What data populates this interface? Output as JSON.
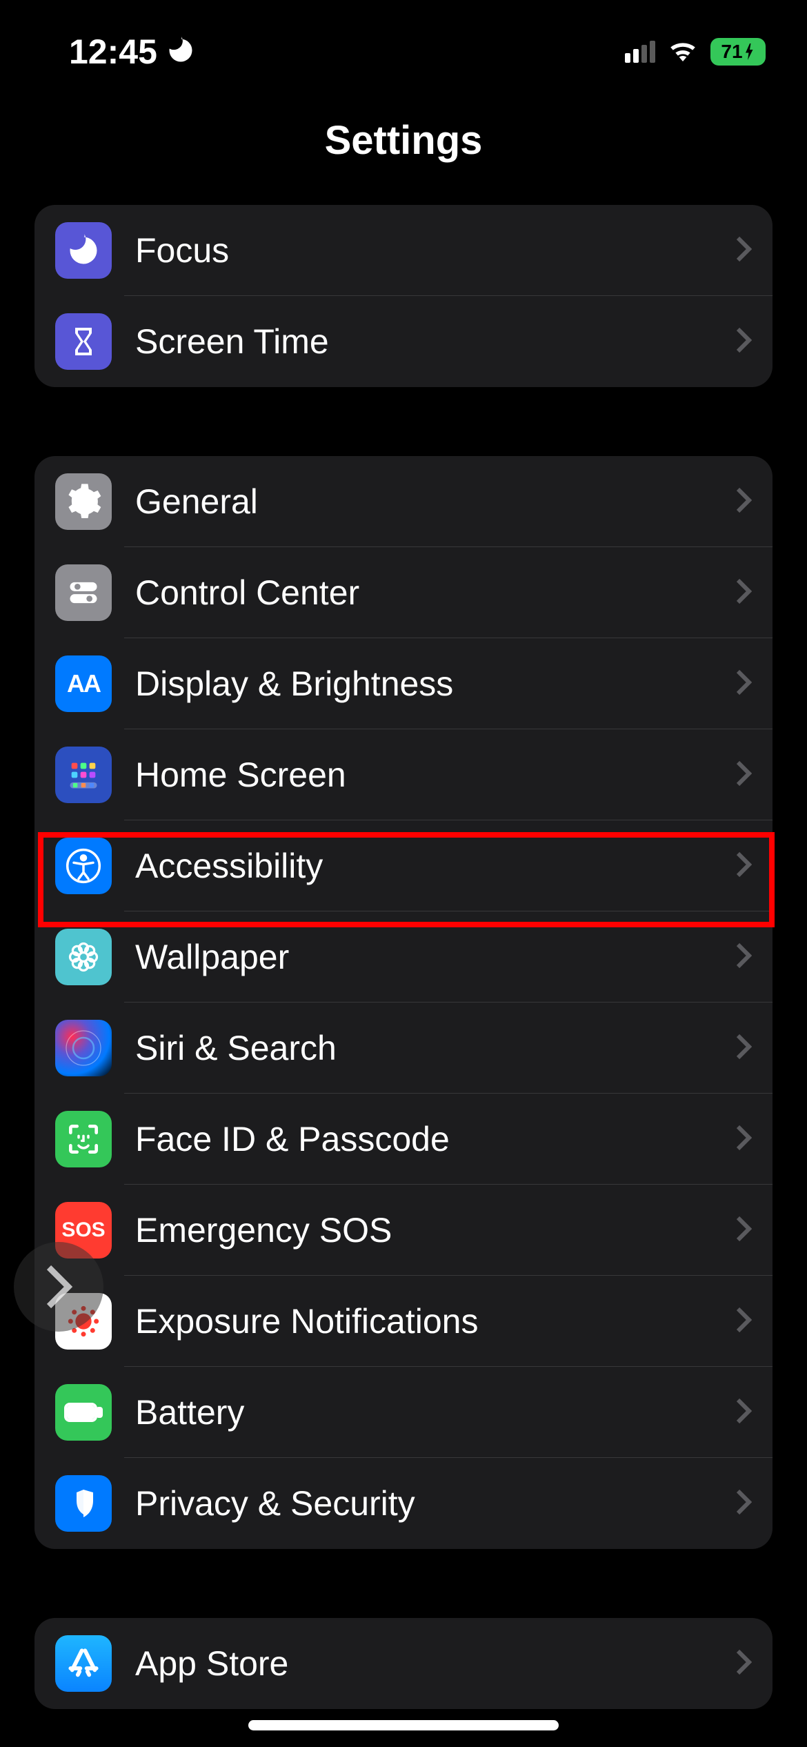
{
  "status_bar": {
    "time": "12:45",
    "battery": "71"
  },
  "header": {
    "title": "Settings"
  },
  "group1": {
    "focus": "Focus",
    "screen_time": "Screen Time"
  },
  "group2": {
    "general": "General",
    "control_center": "Control Center",
    "display_brightness": "Display & Brightness",
    "home_screen": "Home Screen",
    "accessibility": "Accessibility",
    "wallpaper": "Wallpaper",
    "siri_search": "Siri & Search",
    "faceid_passcode": "Face ID & Passcode",
    "emergency_sos": "Emergency SOS",
    "exposure_notifications": "Exposure Notifications",
    "battery": "Battery",
    "privacy_security": "Privacy & Security"
  },
  "group3": {
    "app_store": "App Store"
  },
  "sos_text": "SOS",
  "aa_text": "AA",
  "highlight": {
    "target": "accessibility"
  }
}
